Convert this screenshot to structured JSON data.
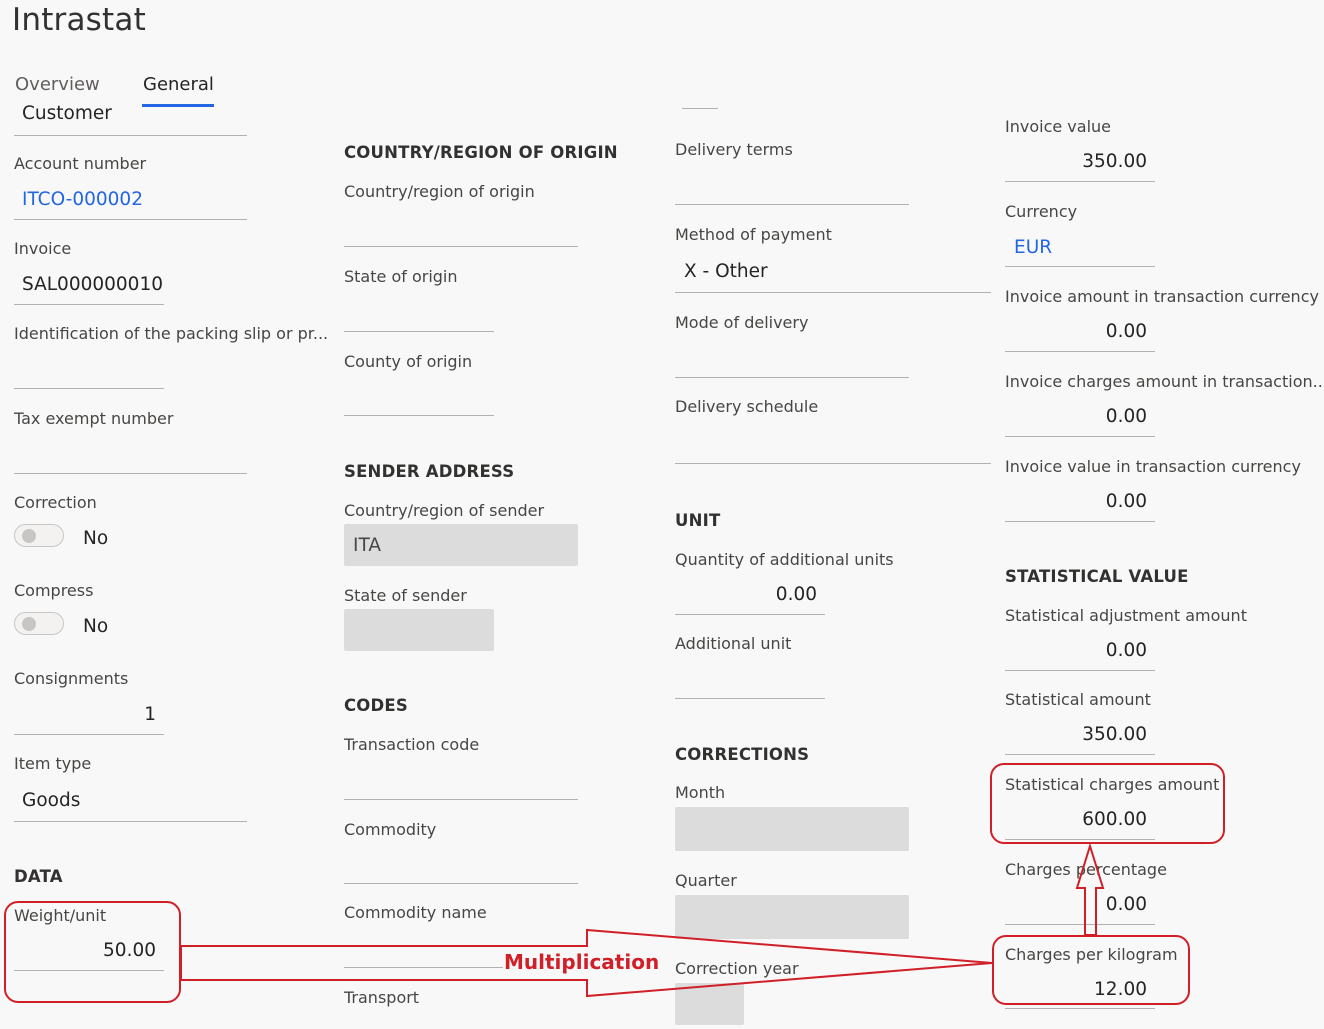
{
  "page": {
    "title": "Intrastat"
  },
  "tabs": [
    {
      "label": "Overview",
      "active": false
    },
    {
      "label": "General",
      "active": true
    }
  ],
  "col1": {
    "customer": "Customer",
    "account_number": {
      "label": "Account number",
      "value": "ITCO-000002"
    },
    "invoice": {
      "label": "Invoice",
      "value": "SAL000000010"
    },
    "packing_slip": {
      "label": "Identification of the packing slip or pr...",
      "value": ""
    },
    "tax_exempt": {
      "label": "Tax exempt number",
      "value": ""
    },
    "correction": {
      "label": "Correction",
      "value": "No"
    },
    "compress": {
      "label": "Compress",
      "value": "No"
    },
    "consignments": {
      "label": "Consignments",
      "value": "1"
    },
    "item_type": {
      "label": "Item type",
      "value": "Goods"
    },
    "data_section": "DATA",
    "weight_unit": {
      "label": "Weight/unit",
      "value": "50.00"
    }
  },
  "col2": {
    "origin_section": "COUNTRY/REGION OF ORIGIN",
    "country_origin": {
      "label": "Country/region of origin",
      "value": ""
    },
    "state_origin": {
      "label": "State of origin",
      "value": ""
    },
    "county_origin": {
      "label": "County of origin",
      "value": ""
    },
    "sender_section": "SENDER ADDRESS",
    "country_sender": {
      "label": "Country/region of sender",
      "value": "ITA"
    },
    "state_sender": {
      "label": "State of sender",
      "value": ""
    },
    "codes_section": "CODES",
    "transaction_code": {
      "label": "Transaction code",
      "value": ""
    },
    "commodity": {
      "label": "Commodity",
      "value": ""
    },
    "commodity_name": {
      "label": "Commodity name",
      "value": ""
    },
    "transport": {
      "label": "Transport",
      "value": ""
    }
  },
  "col3": {
    "delivery_terms": {
      "label": "Delivery terms",
      "value": ""
    },
    "method_payment": {
      "label": "Method of payment",
      "value": "X - Other"
    },
    "mode_delivery": {
      "label": "Mode of delivery",
      "value": ""
    },
    "delivery_schedule": {
      "label": "Delivery schedule",
      "value": ""
    },
    "unit_section": "UNIT",
    "qty_additional": {
      "label": "Quantity of additional units",
      "value": "0.00"
    },
    "additional_unit": {
      "label": "Additional unit",
      "value": ""
    },
    "corrections_section": "CORRECTIONS",
    "month": {
      "label": "Month",
      "value": ""
    },
    "quarter": {
      "label": "Quarter",
      "value": ""
    },
    "correction_year": {
      "label": "Correction year",
      "value": ""
    }
  },
  "col4": {
    "invoice_value": {
      "label": "Invoice value",
      "value": "350.00"
    },
    "currency": {
      "label": "Currency",
      "value": "EUR"
    },
    "invoice_amount_tc": {
      "label": "Invoice amount in transaction currency",
      "value": "0.00"
    },
    "invoice_charges_tc": {
      "label": "Invoice charges amount in transaction...",
      "value": "0.00"
    },
    "invoice_value_tc": {
      "label": "Invoice value in transaction currency",
      "value": "0.00"
    },
    "stat_section": "STATISTICAL VALUE",
    "stat_adjustment": {
      "label": "Statistical adjustment amount",
      "value": "0.00"
    },
    "stat_amount": {
      "label": "Statistical amount",
      "value": "350.00"
    },
    "stat_charges": {
      "label": "Statistical charges amount",
      "value": "600.00"
    },
    "charges_pct": {
      "label": "Charges percentage",
      "value": "0.00"
    },
    "charges_per_kg": {
      "label": "Charges per kilogram",
      "value": "12.00"
    }
  },
  "annotation": {
    "multiplication_label": "Multiplication",
    "color": "#d11f28"
  }
}
